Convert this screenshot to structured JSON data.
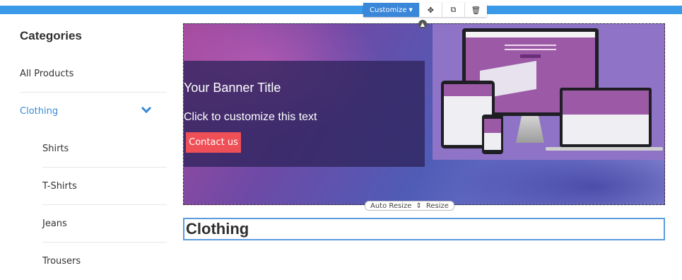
{
  "toolbar": {
    "customize_label": "Customize",
    "move_icon": "move-icon",
    "duplicate_icon": "duplicate-icon",
    "delete_icon": "trash-icon"
  },
  "colors": {
    "accent": "#3a9ae8",
    "active_link": "#3a8bd6",
    "contact_button": "#ef4f56"
  },
  "sidebar": {
    "title": "Categories",
    "items": [
      {
        "label": "All Products"
      },
      {
        "label": "Clothing",
        "active": true
      }
    ],
    "subitems": [
      {
        "label": "Shirts"
      },
      {
        "label": "T-Shirts"
      },
      {
        "label": "Jeans"
      },
      {
        "label": "Trousers"
      }
    ]
  },
  "banner": {
    "title": "Your Banner Title",
    "subtitle": "Click to customize this text",
    "button_label": "Contact us",
    "resize": {
      "auto_label": "Auto Resize",
      "resize_label": "Resize"
    }
  },
  "main": {
    "heading": "Clothing"
  }
}
